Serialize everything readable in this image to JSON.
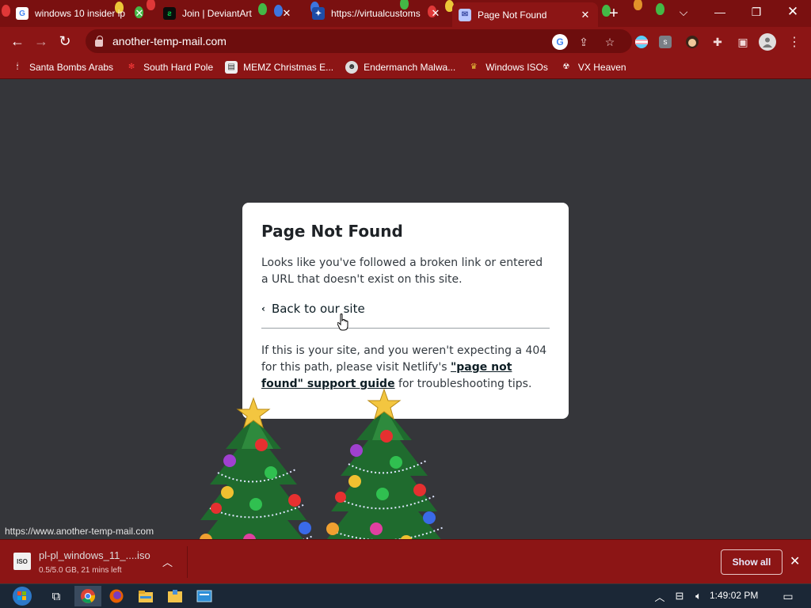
{
  "tabs": [
    {
      "title": "windows 10 insider ip",
      "favicon": "google-icon"
    },
    {
      "title": "Join | DeviantArt",
      "favicon": "deviantart-icon"
    },
    {
      "title": "https://virtualcustoms",
      "favicon": "virtualcustoms-icon"
    },
    {
      "title": "Page Not Found",
      "favicon": "mail-icon",
      "active": true
    }
  ],
  "new_tab_label": "+",
  "address_bar": {
    "url": "another-temp-mail.com"
  },
  "bookmarks": [
    {
      "label": "Santa Bombs Arabs",
      "icon": "santa-icon"
    },
    {
      "label": "South Hard Pole",
      "icon": "snowflake-icon"
    },
    {
      "label": "MEMZ Christmas E...",
      "icon": "memz-icon"
    },
    {
      "label": "Endermanch Malwa...",
      "icon": "endermanch-icon"
    },
    {
      "label": "Windows ISOs",
      "icon": "windows-iso-icon"
    },
    {
      "label": "VX Heaven",
      "icon": "vx-heaven-icon"
    }
  ],
  "card": {
    "title": "Page Not Found",
    "body": "Looks like you've followed a broken link or entered a URL that doesn't exist on this site.",
    "back_link": "Back to our site",
    "footer_pre": "If this is your site, and you weren't expecting a 404 for this path, please visit Netlify's ",
    "footer_link": "\"page not found\" support guide",
    "footer_post": " for troubleshooting tips."
  },
  "status_url": "https://www.another-temp-mail.com",
  "download": {
    "icon_text": "ISO",
    "filename": "pl-pl_windows_11_....iso",
    "progress": "0.5/5.0 GB, 21 mins left",
    "show_all": "Show all"
  },
  "taskbar": {
    "time": "1:49:02 PM"
  },
  "colors": {
    "accent": "#8c1515",
    "page_bg": "#35363a",
    "card_bg": "#ffffff"
  }
}
